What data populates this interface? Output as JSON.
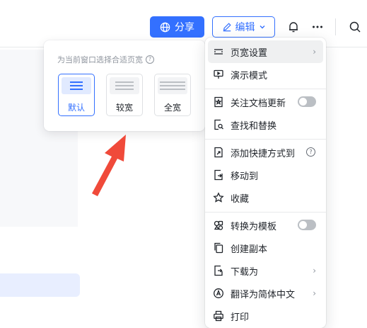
{
  "toolbar": {
    "share_label": "分享",
    "edit_label": "编辑"
  },
  "page_width_popover": {
    "title": "为当前窗口选择合适页宽",
    "help_icon": "?",
    "options": [
      {
        "label": "默认",
        "selected": true
      },
      {
        "label": "较宽",
        "selected": false
      },
      {
        "label": "全宽",
        "selected": false
      }
    ]
  },
  "menu": {
    "items": [
      {
        "label": "页宽设置",
        "icon": "page-width-icon",
        "has_submenu": true
      },
      {
        "label": "演示模式",
        "icon": "presentation-icon"
      },
      {
        "label": "关注文档更新",
        "icon": "follow-doc-icon",
        "toggle": false
      },
      {
        "label": "查找和替换",
        "icon": "find-replace-icon"
      },
      {
        "label": "添加快捷方式到",
        "icon": "shortcut-icon",
        "help": "?"
      },
      {
        "label": "移动到",
        "icon": "move-icon"
      },
      {
        "label": "收藏",
        "icon": "star-icon"
      },
      {
        "label": "转换为模板",
        "icon": "template-icon",
        "toggle": false
      },
      {
        "label": "创建副本",
        "icon": "copy-icon"
      },
      {
        "label": "下载为",
        "icon": "download-icon",
        "has_submenu": true
      },
      {
        "label": "翻译为简体中文",
        "icon": "translate-icon",
        "has_submenu": true
      },
      {
        "label": "打印",
        "icon": "print-icon"
      }
    ]
  },
  "colors": {
    "accent": "#3370ff",
    "arrow": "#f04a3a"
  }
}
